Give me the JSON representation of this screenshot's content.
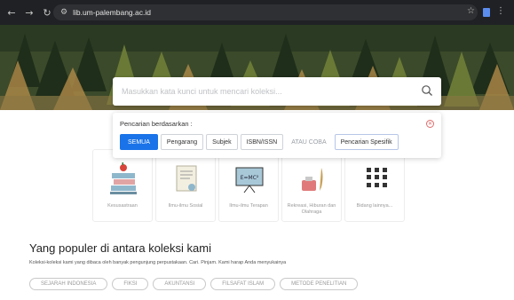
{
  "browser": {
    "url": "lib.um-palembang.ac.id"
  },
  "search": {
    "placeholder": "Masukkan kata kunci untuk mencari koleksi..."
  },
  "filter": {
    "label": "Pencarian berdasarkan :",
    "options": [
      "SEMUA",
      "Pengarang",
      "Subjek",
      "ISBN/ISSN",
      "ATAU COBA",
      "Pencarian Spesifik"
    ],
    "active": "SEMUA"
  },
  "categories": [
    {
      "label": "Kesusastraan",
      "icon": "books-icon"
    },
    {
      "label": "Ilmu-ilmu Sosial",
      "icon": "certificate-icon"
    },
    {
      "label": "Ilmu-ilmu Terapan",
      "icon": "formula-board-icon"
    },
    {
      "label": "Rekreasi, Hiburan dan Olahraga",
      "icon": "ink-quill-icon"
    },
    {
      "label": "Bidang lainnya...",
      "icon": "grid-dots-icon"
    }
  ],
  "popular": {
    "title": "Yang populer di antara koleksi kami",
    "subtitle": "Koleksi-koleksi kami yang dibaca oleh banyak pengunjung perpustakaan. Cari. Pinjam. Kami harap Anda menyukainya",
    "chips": [
      "SEJARAH INDONESIA",
      "FIKSI",
      "AKUNTANSI",
      "FILSAFAT ISLAM",
      "METODE PENELITIAN"
    ]
  },
  "colors": {
    "accent": "#1a73e8",
    "chrome": "#202124",
    "close": "#e06b6b"
  }
}
